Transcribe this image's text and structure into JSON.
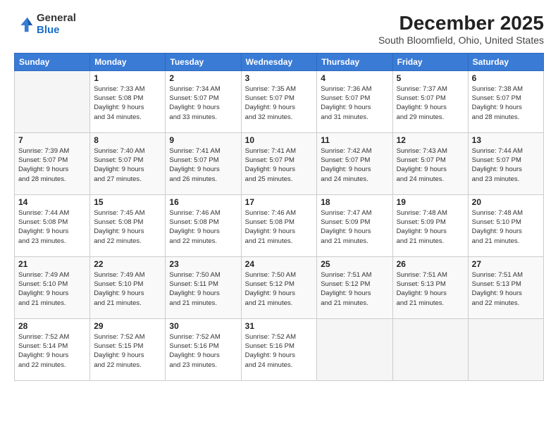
{
  "logo": {
    "line1": "General",
    "line2": "Blue"
  },
  "title": "December 2025",
  "location": "South Bloomfield, Ohio, United States",
  "days_header": [
    "Sunday",
    "Monday",
    "Tuesday",
    "Wednesday",
    "Thursday",
    "Friday",
    "Saturday"
  ],
  "weeks": [
    [
      {
        "num": "",
        "detail": ""
      },
      {
        "num": "1",
        "detail": "Sunrise: 7:33 AM\nSunset: 5:08 PM\nDaylight: 9 hours\nand 34 minutes."
      },
      {
        "num": "2",
        "detail": "Sunrise: 7:34 AM\nSunset: 5:07 PM\nDaylight: 9 hours\nand 33 minutes."
      },
      {
        "num": "3",
        "detail": "Sunrise: 7:35 AM\nSunset: 5:07 PM\nDaylight: 9 hours\nand 32 minutes."
      },
      {
        "num": "4",
        "detail": "Sunrise: 7:36 AM\nSunset: 5:07 PM\nDaylight: 9 hours\nand 31 minutes."
      },
      {
        "num": "5",
        "detail": "Sunrise: 7:37 AM\nSunset: 5:07 PM\nDaylight: 9 hours\nand 29 minutes."
      },
      {
        "num": "6",
        "detail": "Sunrise: 7:38 AM\nSunset: 5:07 PM\nDaylight: 9 hours\nand 28 minutes."
      }
    ],
    [
      {
        "num": "7",
        "detail": "Sunrise: 7:39 AM\nSunset: 5:07 PM\nDaylight: 9 hours\nand 28 minutes."
      },
      {
        "num": "8",
        "detail": "Sunrise: 7:40 AM\nSunset: 5:07 PM\nDaylight: 9 hours\nand 27 minutes."
      },
      {
        "num": "9",
        "detail": "Sunrise: 7:41 AM\nSunset: 5:07 PM\nDaylight: 9 hours\nand 26 minutes."
      },
      {
        "num": "10",
        "detail": "Sunrise: 7:41 AM\nSunset: 5:07 PM\nDaylight: 9 hours\nand 25 minutes."
      },
      {
        "num": "11",
        "detail": "Sunrise: 7:42 AM\nSunset: 5:07 PM\nDaylight: 9 hours\nand 24 minutes."
      },
      {
        "num": "12",
        "detail": "Sunrise: 7:43 AM\nSunset: 5:07 PM\nDaylight: 9 hours\nand 24 minutes."
      },
      {
        "num": "13",
        "detail": "Sunrise: 7:44 AM\nSunset: 5:07 PM\nDaylight: 9 hours\nand 23 minutes."
      }
    ],
    [
      {
        "num": "14",
        "detail": "Sunrise: 7:44 AM\nSunset: 5:08 PM\nDaylight: 9 hours\nand 23 minutes."
      },
      {
        "num": "15",
        "detail": "Sunrise: 7:45 AM\nSunset: 5:08 PM\nDaylight: 9 hours\nand 22 minutes."
      },
      {
        "num": "16",
        "detail": "Sunrise: 7:46 AM\nSunset: 5:08 PM\nDaylight: 9 hours\nand 22 minutes."
      },
      {
        "num": "17",
        "detail": "Sunrise: 7:46 AM\nSunset: 5:08 PM\nDaylight: 9 hours\nand 21 minutes."
      },
      {
        "num": "18",
        "detail": "Sunrise: 7:47 AM\nSunset: 5:09 PM\nDaylight: 9 hours\nand 21 minutes."
      },
      {
        "num": "19",
        "detail": "Sunrise: 7:48 AM\nSunset: 5:09 PM\nDaylight: 9 hours\nand 21 minutes."
      },
      {
        "num": "20",
        "detail": "Sunrise: 7:48 AM\nSunset: 5:10 PM\nDaylight: 9 hours\nand 21 minutes."
      }
    ],
    [
      {
        "num": "21",
        "detail": "Sunrise: 7:49 AM\nSunset: 5:10 PM\nDaylight: 9 hours\nand 21 minutes."
      },
      {
        "num": "22",
        "detail": "Sunrise: 7:49 AM\nSunset: 5:10 PM\nDaylight: 9 hours\nand 21 minutes."
      },
      {
        "num": "23",
        "detail": "Sunrise: 7:50 AM\nSunset: 5:11 PM\nDaylight: 9 hours\nand 21 minutes."
      },
      {
        "num": "24",
        "detail": "Sunrise: 7:50 AM\nSunset: 5:12 PM\nDaylight: 9 hours\nand 21 minutes."
      },
      {
        "num": "25",
        "detail": "Sunrise: 7:51 AM\nSunset: 5:12 PM\nDaylight: 9 hours\nand 21 minutes."
      },
      {
        "num": "26",
        "detail": "Sunrise: 7:51 AM\nSunset: 5:13 PM\nDaylight: 9 hours\nand 21 minutes."
      },
      {
        "num": "27",
        "detail": "Sunrise: 7:51 AM\nSunset: 5:13 PM\nDaylight: 9 hours\nand 22 minutes."
      }
    ],
    [
      {
        "num": "28",
        "detail": "Sunrise: 7:52 AM\nSunset: 5:14 PM\nDaylight: 9 hours\nand 22 minutes."
      },
      {
        "num": "29",
        "detail": "Sunrise: 7:52 AM\nSunset: 5:15 PM\nDaylight: 9 hours\nand 22 minutes."
      },
      {
        "num": "30",
        "detail": "Sunrise: 7:52 AM\nSunset: 5:16 PM\nDaylight: 9 hours\nand 23 minutes."
      },
      {
        "num": "31",
        "detail": "Sunrise: 7:52 AM\nSunset: 5:16 PM\nDaylight: 9 hours\nand 24 minutes."
      },
      {
        "num": "",
        "detail": ""
      },
      {
        "num": "",
        "detail": ""
      },
      {
        "num": "",
        "detail": ""
      }
    ]
  ]
}
